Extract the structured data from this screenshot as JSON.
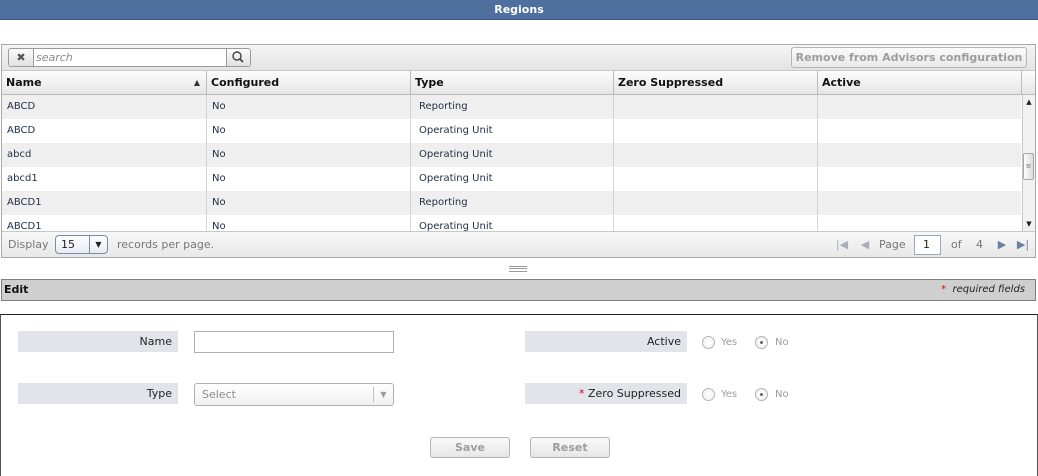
{
  "window": {
    "title": "Regions"
  },
  "toolbar": {
    "search_placeholder": "search",
    "remove_label": "Remove from Advisors configuration"
  },
  "grid": {
    "columns": [
      "Name",
      "Configured",
      "Type",
      "Zero Suppressed",
      "Active"
    ],
    "sorted_column": "Name",
    "sort_direction": "ascending",
    "rows": [
      {
        "name": "ABCD",
        "configured": "No",
        "type": "Reporting",
        "zero_suppressed": "",
        "active": ""
      },
      {
        "name": "ABCD",
        "configured": "No",
        "type": "Operating Unit",
        "zero_suppressed": "",
        "active": ""
      },
      {
        "name": "abcd",
        "configured": "No",
        "type": "Operating Unit",
        "zero_suppressed": "",
        "active": ""
      },
      {
        "name": "abcd1",
        "configured": "No",
        "type": "Operating Unit",
        "zero_suppressed": "",
        "active": ""
      },
      {
        "name": "ABCD1",
        "configured": "No",
        "type": "Reporting",
        "zero_suppressed": "",
        "active": ""
      },
      {
        "name": "ABCD1",
        "configured": "No",
        "type": "Operating Unit",
        "zero_suppressed": "",
        "active": ""
      }
    ]
  },
  "pager": {
    "display_label": "Display",
    "page_size": "15",
    "records_label": "records per page.",
    "page_label": "Page",
    "current_page": "1",
    "of_label": "of",
    "total_pages": "4"
  },
  "edit": {
    "title": "Edit",
    "required_note": "required fields",
    "asterisk": "*",
    "name_label": "Name",
    "name_value": "",
    "type_label": "Type",
    "type_placeholder": "Select",
    "active_label": "Active",
    "zero_suppressed_label": "Zero Suppressed",
    "yes_label": "Yes",
    "no_label": "No",
    "active_value": "No",
    "zero_suppressed_value": "No",
    "save_label": "Save",
    "reset_label": "Reset"
  }
}
